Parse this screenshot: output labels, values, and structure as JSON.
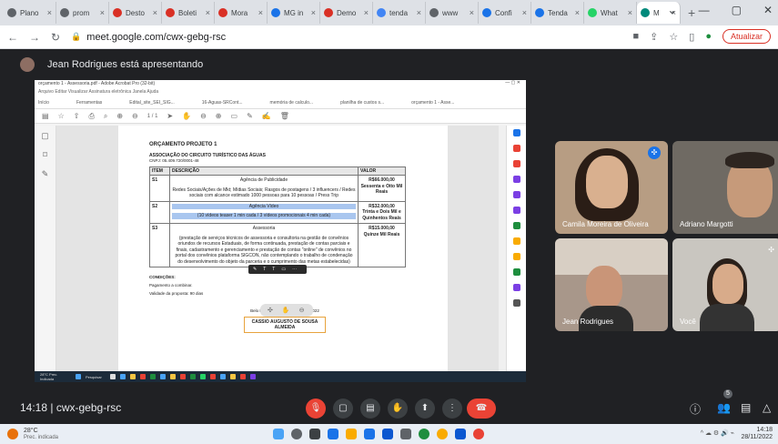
{
  "browser": {
    "tabs": [
      {
        "label": "Plano",
        "color": "#5f6368"
      },
      {
        "label": "prom",
        "color": "#5f6368"
      },
      {
        "label": "Desto",
        "color": "#d93025"
      },
      {
        "label": "Boleti",
        "color": "#d93025"
      },
      {
        "label": "Mora",
        "color": "#d93025"
      },
      {
        "label": "MG in",
        "color": "#1a73e8"
      },
      {
        "label": "Demo",
        "color": "#d93025"
      },
      {
        "label": "tenda",
        "color": "#4285f4"
      },
      {
        "label": "www",
        "color": "#5f6368"
      },
      {
        "label": "Confi",
        "color": "#1a73e8"
      },
      {
        "label": "Tenda",
        "color": "#1a73e8"
      },
      {
        "label": "What",
        "color": "#25d366"
      }
    ],
    "active_tab": "M",
    "url": "meet.google.com/cwx-gebg-rsc",
    "update_label": "Atualizar"
  },
  "presenter": {
    "text": "Jean Rodrigues está apresentando"
  },
  "shared_screen": {
    "window_title": "orçamento 1 - Assessoria.pdf - Adobe Acrobat Pro (32-bit)",
    "menu": "Arquivo  Editar  Visualizar  Assinatura eletrônica  Janela  Ajuda",
    "tabs": [
      "Início",
      "Ferramentas",
      "Edital_site_SEI_SIG...",
      "16-Aguas-SRCont...",
      "memória de calculo...",
      "planilha de custos s...",
      "orçamento 1 - Asse..."
    ],
    "zoom": "1 / 1",
    "doc": {
      "title": "ORÇAMENTO PROJETO 1",
      "org": "ASSOCIAÇÃO DO CIRCUITO TURÍSTICO DAS ÁGUAS",
      "cnpj": "CNPJ: 05.409.720/0001-48",
      "headers": [
        "ITEM",
        "DESCRIÇÃO",
        "VALOR"
      ],
      "rows": [
        {
          "item": "S1",
          "title": "Agência de Publicidade",
          "desc": "Redes Sociais/Ações de Mkt; Mídias Sociais; Rasgos de postagens / 3 influencers / Redes sociais com alcance estimado 1000 pessoas para 10 pessoas / Press Trip",
          "value": "R$66.000,00",
          "value_text": "Sessenta e Oito Mil Reais"
        },
        {
          "item": "S2",
          "title": "Agência Vídeo",
          "desc": "(10 vídeos teaser 1 min cada / 3 vídeos promocionais 4 min cada)",
          "value": "R$32.000,00",
          "value_text": "Trinta e Dois Mil e Quinhentos Reais"
        },
        {
          "item": "S3",
          "title": "Assessoria",
          "desc": "(prestação de serviços técnicos de assessoria e consultoria na gestão de convênios oriundos de recursos Estaduais, de forma continuada, prestação de contas parciais e finais, cadastramento e gerenciamento e prestação de contas \"online\" de convênios no portal dos convênios plataforma SIGCON, não contemplando o trabalho de condenação do desenvolvimento do objeto da parceria e o cumprimento das metas estabelecidas)",
          "value": "R$15.000,00",
          "value_text": "Quinze Mil Reais"
        }
      ],
      "conditions_label": "CONDIÇÕES:",
      "payment": "Pagamento a combinar.",
      "validity": "Validade da proposta: 90 dias",
      "place_date": "Belo Horizonte, 23 de Agosto de 2022",
      "signer": "CASSIO AUGUSTO DE SOUSA ALMEIDA"
    },
    "taskbar_weather": "28°C Prec. Indicada",
    "taskbar_search": "Pesquisar"
  },
  "participants": [
    {
      "name": "Camila Moreira de Oliveira"
    },
    {
      "name": "Adriano Margotti"
    },
    {
      "name": "Jean Rodrigues"
    },
    {
      "name": "Você"
    }
  ],
  "meeting": {
    "time": "14:18",
    "sep": "|",
    "code": "cwx-gebg-rsc",
    "people_count": "5"
  },
  "os_taskbar": {
    "weather_temp": "28°C",
    "weather_desc": "Prec. indicada",
    "time": "14:18",
    "date": "28/11/2022"
  }
}
